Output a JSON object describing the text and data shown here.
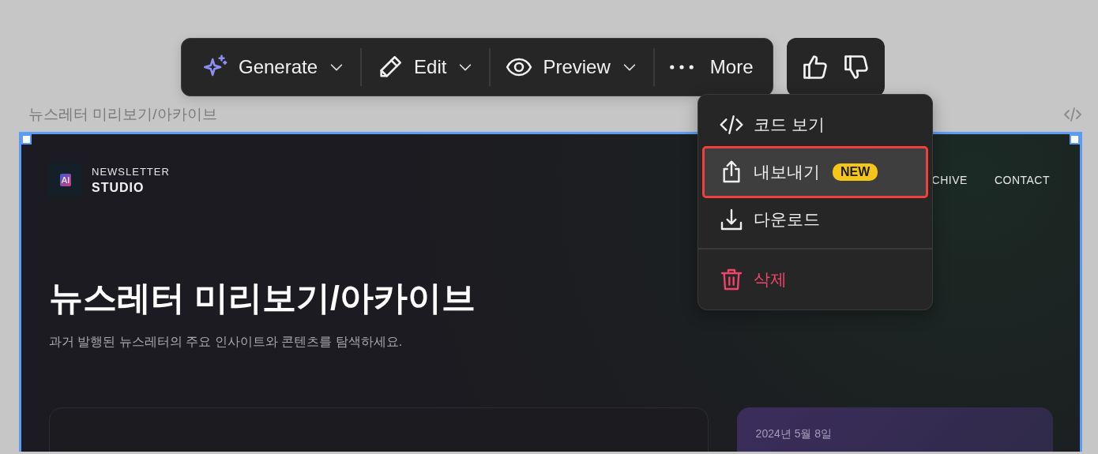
{
  "toolbar": {
    "items": [
      {
        "label": "Generate",
        "has_caret": true
      },
      {
        "label": "Edit",
        "has_caret": true
      },
      {
        "label": "Preview",
        "has_caret": true
      },
      {
        "label": "More",
        "has_caret": false
      }
    ]
  },
  "menu": {
    "items": [
      {
        "kind": "normal",
        "label": "코드 보기",
        "highlighted": false
      },
      {
        "kind": "normal",
        "label": "내보내기",
        "badge": "NEW",
        "highlighted": true
      },
      {
        "kind": "normal",
        "label": "다운로드",
        "highlighted": false
      },
      {
        "kind": "danger",
        "label": "삭제",
        "highlighted": false
      }
    ]
  },
  "canvas": {
    "label": "뉴스레터 미리보기/아카이브",
    "site": {
      "logo_text": "AI",
      "brand_top": "NEWSLETTER",
      "brand_name": "STUDIO",
      "nav": [
        "CHIVE",
        "CONTACT"
      ],
      "heading": "뉴스레터 미리보기/아카이브",
      "subheading": "과거 발행된 뉴스레터의 주요 인사이트와 콘텐츠를 탐색하세요.",
      "cards": [
        {
          "kind": "plain"
        },
        {
          "kind": "featured",
          "date": "2024년 5월 8일"
        }
      ]
    }
  }
}
